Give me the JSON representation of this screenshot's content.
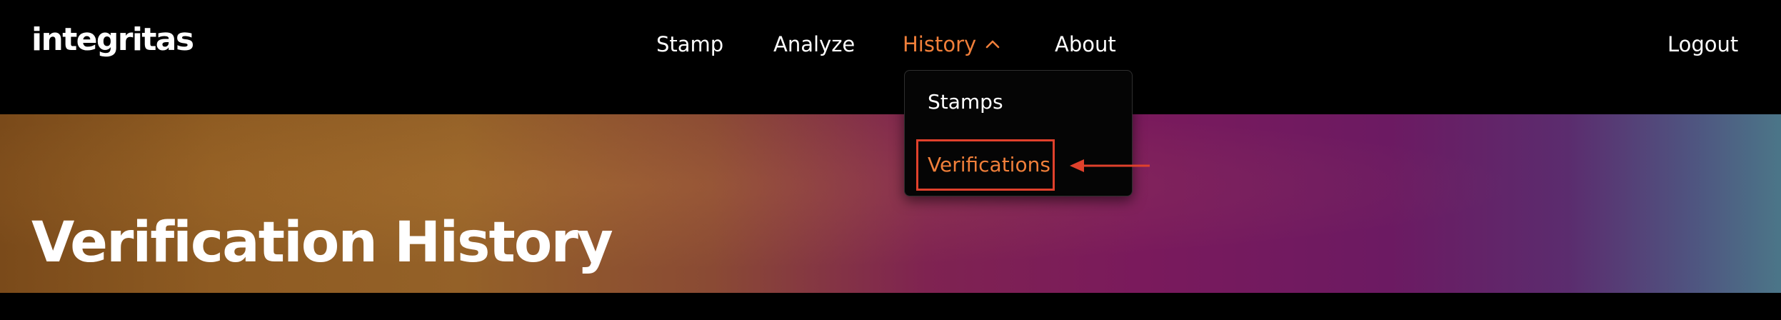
{
  "brand": {
    "logo_text": "integritas"
  },
  "nav": {
    "items": [
      {
        "label": "Stamp"
      },
      {
        "label": "Analyze"
      },
      {
        "label": "History",
        "active": true
      },
      {
        "label": "About"
      }
    ],
    "logout_label": "Logout"
  },
  "history_menu": {
    "expanded": true,
    "items": [
      {
        "label": "Stamps"
      },
      {
        "label": "Verifications",
        "selected": true
      }
    ]
  },
  "page": {
    "title": "Verification History"
  },
  "icons": {
    "history_chevron": "chevron-up-icon",
    "annotation_arrow": "arrow-left-icon"
  },
  "colors": {
    "background": "#000000",
    "text": "#ffffff",
    "accent": "#f07f3a",
    "annotation": "#e0412c",
    "hero_gradient": [
      "#7a4a1a",
      "#946128",
      "#7f2351",
      "#6c1a62",
      "#4b7688"
    ]
  }
}
